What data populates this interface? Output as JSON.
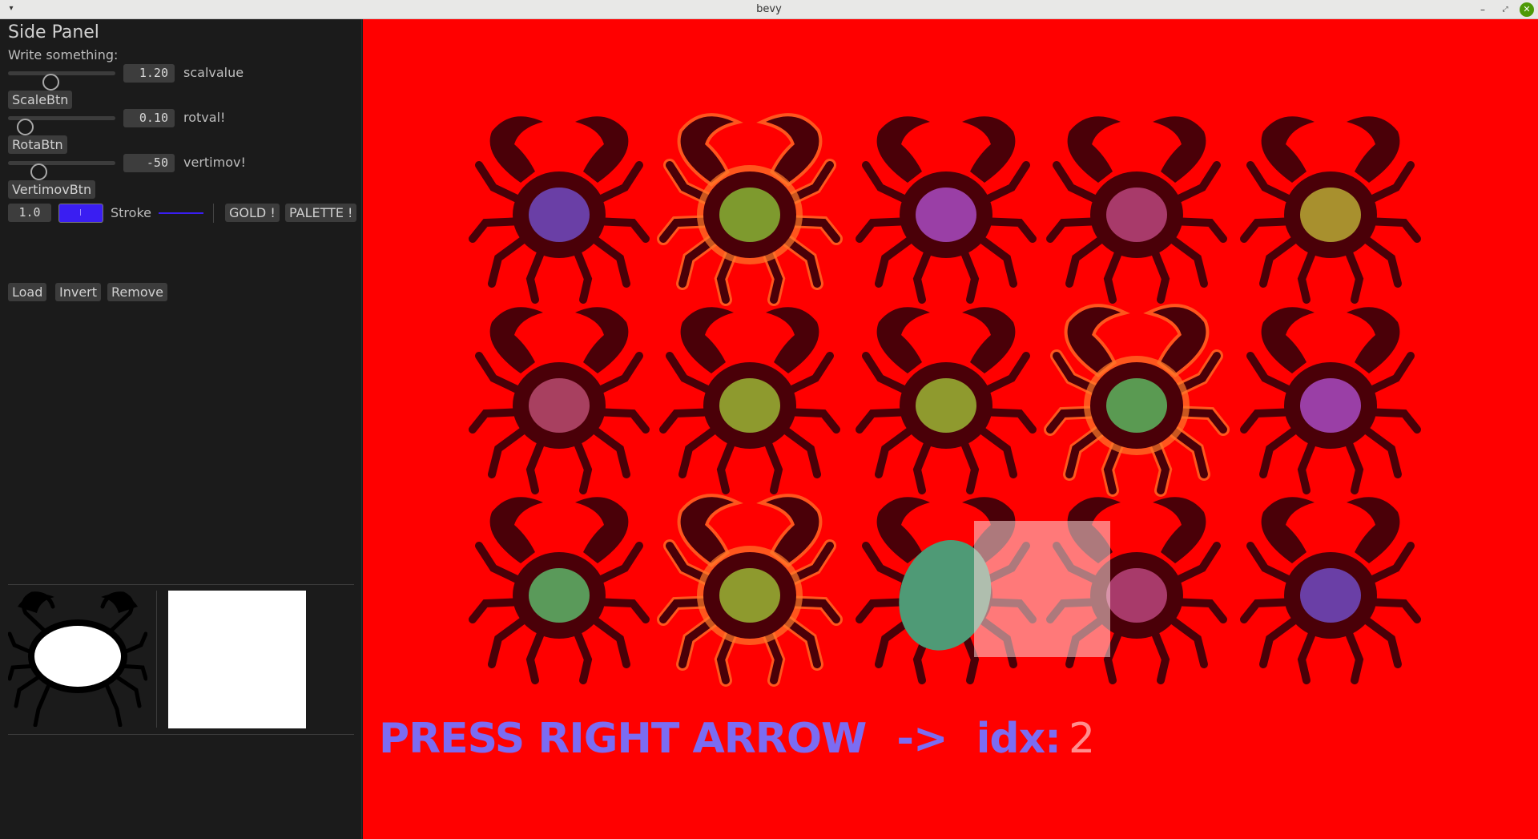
{
  "window": {
    "title": "bevy",
    "menu_icon": "chevron-down-icon",
    "minimize_icon": "minimize-icon",
    "maximize_icon": "maximize-icon",
    "close_icon": "close-icon"
  },
  "side_panel": {
    "heading": "Side Panel",
    "write_label": "Write something:",
    "sliders": [
      {
        "value_text": "1.20",
        "label": "scalvalue",
        "button": "ScaleBtn",
        "fraction": 0.38
      },
      {
        "value_text": "0.10",
        "label": "rotval!",
        "button": "RotaBtn",
        "fraction": 0.1
      },
      {
        "value_text": "-50",
        "label": "vertimov!",
        "button": "VertimovBtn",
        "fraction": 0.25
      }
    ],
    "stroke": {
      "width_value": "1.0",
      "label": "Stroke",
      "color": "#3a1ef2"
    },
    "gold_button": "GOLD !",
    "palette_button": "PALETTE !",
    "load_button": "Load",
    "invert_button": "Invert",
    "remove_button": "Remove"
  },
  "viewport": {
    "background": "#ff0000",
    "instruction": "PRESS RIGHT ARROW",
    "arrow": "->",
    "idx_label": "idx:",
    "idx_value": "2",
    "selected_index": 12,
    "crabs": [
      {
        "style": "dark",
        "body": "#6a3fa6"
      },
      {
        "style": "orange",
        "body": "#7e9a2e"
      },
      {
        "style": "dark",
        "body": "#9a3fa6"
      },
      {
        "style": "dark",
        "body": "#a83a6a"
      },
      {
        "style": "dark",
        "body": "#a8902e"
      },
      {
        "style": "dark",
        "body": "#a84060"
      },
      {
        "style": "dark",
        "body": "#8e9a2e"
      },
      {
        "style": "dark",
        "body": "#8f9a2e"
      },
      {
        "style": "orange",
        "body": "#5a9a52"
      },
      {
        "style": "dark",
        "body": "#9a3fa6"
      },
      {
        "style": "dark",
        "body": "#5a9a5a"
      },
      {
        "style": "orange",
        "body": "#8e9a2e"
      },
      {
        "style": "dark",
        "body": "#4f9a76"
      },
      {
        "style": "dark",
        "body": "#a83a6a"
      },
      {
        "style": "dark",
        "body": "#6a3fa6"
      }
    ]
  }
}
